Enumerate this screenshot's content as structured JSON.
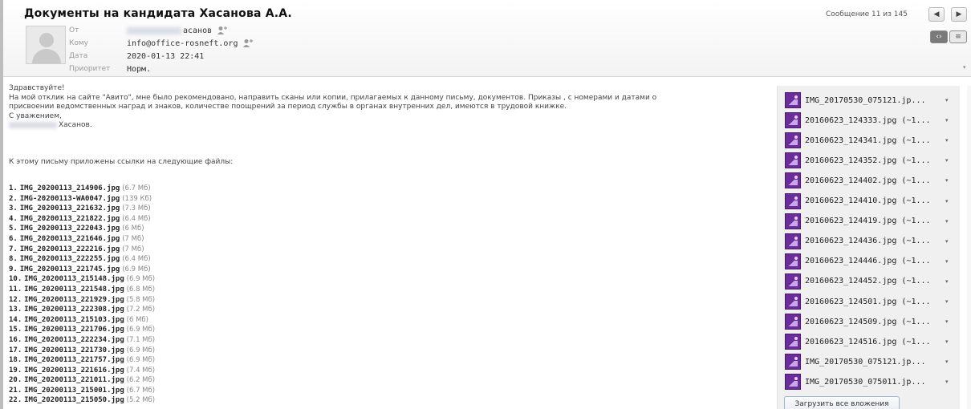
{
  "message": {
    "subject": "Документы на кандидата Хасанова А.А.",
    "counter": "Сообщение 11 из 145",
    "nav_prev": "◀",
    "nav_next": "▶",
    "meta": {
      "from_label": "От",
      "from_value": "асанов",
      "to_label": "Кому",
      "to_value": "info@office-rosneft.org",
      "date_label": "Дата",
      "date_value": "2020-01-13 22:41",
      "priority_label": "Приоритет",
      "priority_value": "Норм."
    },
    "view_buttons": [
      "‹›",
      "≡"
    ]
  },
  "body": {
    "lines": [
      "Здравствуйте!",
      "На мой отклик на сайте \"Авито\", мне было рекомендовано, направить сканы или копии, прилагаемых к данному письму, документов. Приказы , с номерами и датами о",
      "присвоении ведомственных наград и знаков, количестве поощрений за период службы в органах внутренних дел, имеются в трудовой книжке.",
      "С уважением,"
    ],
    "signature": "Хасанов.",
    "files_intro": "К этому письму приложены ссылки на следующие файлы:"
  },
  "files": [
    {
      "n": "1.",
      "name": "IMG_20200113_214906.jpg",
      "size": "(6.7 Мб)"
    },
    {
      "n": "2.",
      "name": "IMG-20200113-WA0047.jpg",
      "size": "(139 Кб)"
    },
    {
      "n": "3.",
      "name": "IMG_20200113_221632.jpg",
      "size": "(7.3 Мб)"
    },
    {
      "n": "4.",
      "name": "IMG_20200113_221822.jpg",
      "size": "(6.4 Мб)"
    },
    {
      "n": "5.",
      "name": "IMG_20200113_222043.jpg",
      "size": "(6 Мб)"
    },
    {
      "n": "6.",
      "name": "IMG_20200113_221646.jpg",
      "size": "(7 Мб)"
    },
    {
      "n": "7.",
      "name": "IMG_20200113_222216.jpg",
      "size": "(7 Мб)"
    },
    {
      "n": "8.",
      "name": "IMG_20200113_222255.jpg",
      "size": "(6.4 Мб)"
    },
    {
      "n": "9.",
      "name": "IMG_20200113_221745.jpg",
      "size": "(6.9 Мб)"
    },
    {
      "n": "10.",
      "name": "IMG_20200113_215148.jpg",
      "size": "(6.9 Мб)"
    },
    {
      "n": "11.",
      "name": "IMG_20200113_221548.jpg",
      "size": "(6.8 Мб)"
    },
    {
      "n": "12.",
      "name": "IMG_20200113_221929.jpg",
      "size": "(5.8 Мб)"
    },
    {
      "n": "13.",
      "name": "IMG_20200113_222308.jpg",
      "size": "(7.2 Мб)"
    },
    {
      "n": "14.",
      "name": "IMG_20200113_215103.jpg",
      "size": "(6 Мб)"
    },
    {
      "n": "15.",
      "name": "IMG_20200113_221706.jpg",
      "size": "(6.9 Мб)"
    },
    {
      "n": "16.",
      "name": "IMG_20200113_222234.jpg",
      "size": "(7.1 Мб)"
    },
    {
      "n": "17.",
      "name": "IMG_20200113_221730.jpg",
      "size": "(6.9 Мб)"
    },
    {
      "n": "18.",
      "name": "IMG_20200113_221757.jpg",
      "size": "(6.9 Мб)"
    },
    {
      "n": "19.",
      "name": "IMG_20200113_221616.jpg",
      "size": "(7.4 Мб)"
    },
    {
      "n": "20.",
      "name": "IMG_20200113_221011.jpg",
      "size": "(6.2 Мб)"
    },
    {
      "n": "21.",
      "name": "IMG_20200113_215001.jpg",
      "size": "(6.7 Мб)"
    },
    {
      "n": "22.",
      "name": "IMG_20200113_215050.jpg",
      "size": "(5.2 Мб)"
    }
  ],
  "attachments": [
    "IMG_20170530_075121.jp...",
    "20160623_124333.jpg (~1...",
    "20160623_124341.jpg (~1...",
    "20160623_124352.jpg (~1...",
    "20160623_124402.jpg (~1...",
    "20160623_124410.jpg (~1...",
    "20160623_124419.jpg (~1...",
    "20160623_124436.jpg (~1...",
    "20160623_124446.jpg (~1...",
    "20160623_124452.jpg (~1...",
    "20160623_124501.jpg (~1...",
    "20160623_124509.jpg (~1...",
    "20160623_124516.jpg (~1...",
    "IMG_20170530_075121.jp...",
    "IMG_20170530_075011.jp..."
  ],
  "load_all_label": "Загрузить все вложения",
  "icons": {
    "person_add": "person-add-icon",
    "attachment": "image-file-icon",
    "caret": "▾"
  }
}
